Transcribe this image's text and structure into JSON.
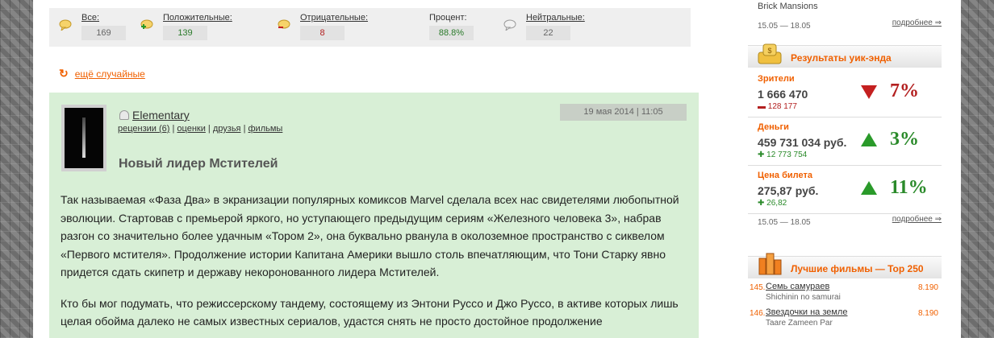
{
  "stats": [
    {
      "label": "Все:",
      "value": "169",
      "tone": "gray"
    },
    {
      "label": "Положительные:",
      "value": "139",
      "tone": "pos"
    },
    {
      "label": "Отрицательные:",
      "value": "8",
      "tone": "neg"
    },
    {
      "label": "Процент:",
      "value": "88.8%",
      "tone": "pos"
    },
    {
      "label": "Нейтральные:",
      "value": "22",
      "tone": "gray"
    }
  ],
  "random_link": "ещё случайные",
  "review": {
    "author": "Elementary",
    "links": [
      "рецензии (6)",
      "оценки",
      "друзья",
      "фильмы"
    ],
    "date": "19 мая 2014 | 11:05",
    "title": "Новый лидер Мстителей",
    "paragraphs": [
      "Так называемая «Фаза Два» в экранизации популярных комиксов Marvel сделала всех нас свидетелями любопытной эволюции. Стартовав с премьерой яркого, но уступающего предыдущим сериям «Железного человека 3», набрав разгон со значительно более удачным «Тором 2», она буквально рванула в околоземное пространство с сиквелом «Первого мстителя». Продолжение истории Капитана Америки вышло столь впечатляющим, что Тони Старку явно придется сдать скипетр и державу некоронованного лидера Мстителей.",
      "Кто бы мог подумать, что режиссерскому тандему, состоящему из Энтони Руссо и Джо Руссо, в активе которых лишь целая обойма далеко не самых известных сериалов, удастся снять не просто достойное продолжение"
    ]
  },
  "sidebar": {
    "prev_item": "Brick Mansions",
    "date_range_1": "15.05 — 18.05",
    "more_1": "подробнее ⇒",
    "weekend_title": "Результаты уик-энда",
    "weekend": [
      {
        "key": "Зрители",
        "value": "1 666 470",
        "delta": "128 177",
        "direction": "down",
        "percent": "7%"
      },
      {
        "key": "Деньги",
        "value": "459 731 034 руб.",
        "delta": "12 773 754",
        "direction": "up",
        "percent": "3%"
      },
      {
        "key": "Цена билета",
        "value": "275,87 руб.",
        "delta": "26,82",
        "direction": "up",
        "percent": "11%"
      }
    ],
    "date_range_2": "15.05 — 18.05",
    "more_2": "подробнее ⇒",
    "top_title": "Лучшие фильмы — Top 250",
    "top": [
      {
        "num": "145.",
        "title": "Семь самураев",
        "orig": "Shichinin no samurai",
        "rating": "8.190"
      },
      {
        "num": "146.",
        "title": "Звездочки на земле",
        "orig": "Taare Zameen Par",
        "rating": "8.190"
      }
    ]
  },
  "colors": {
    "accent": "#f06000",
    "positive": "#2a8a2a",
    "negative": "#b32020",
    "review_bg": "#d8efd6"
  }
}
